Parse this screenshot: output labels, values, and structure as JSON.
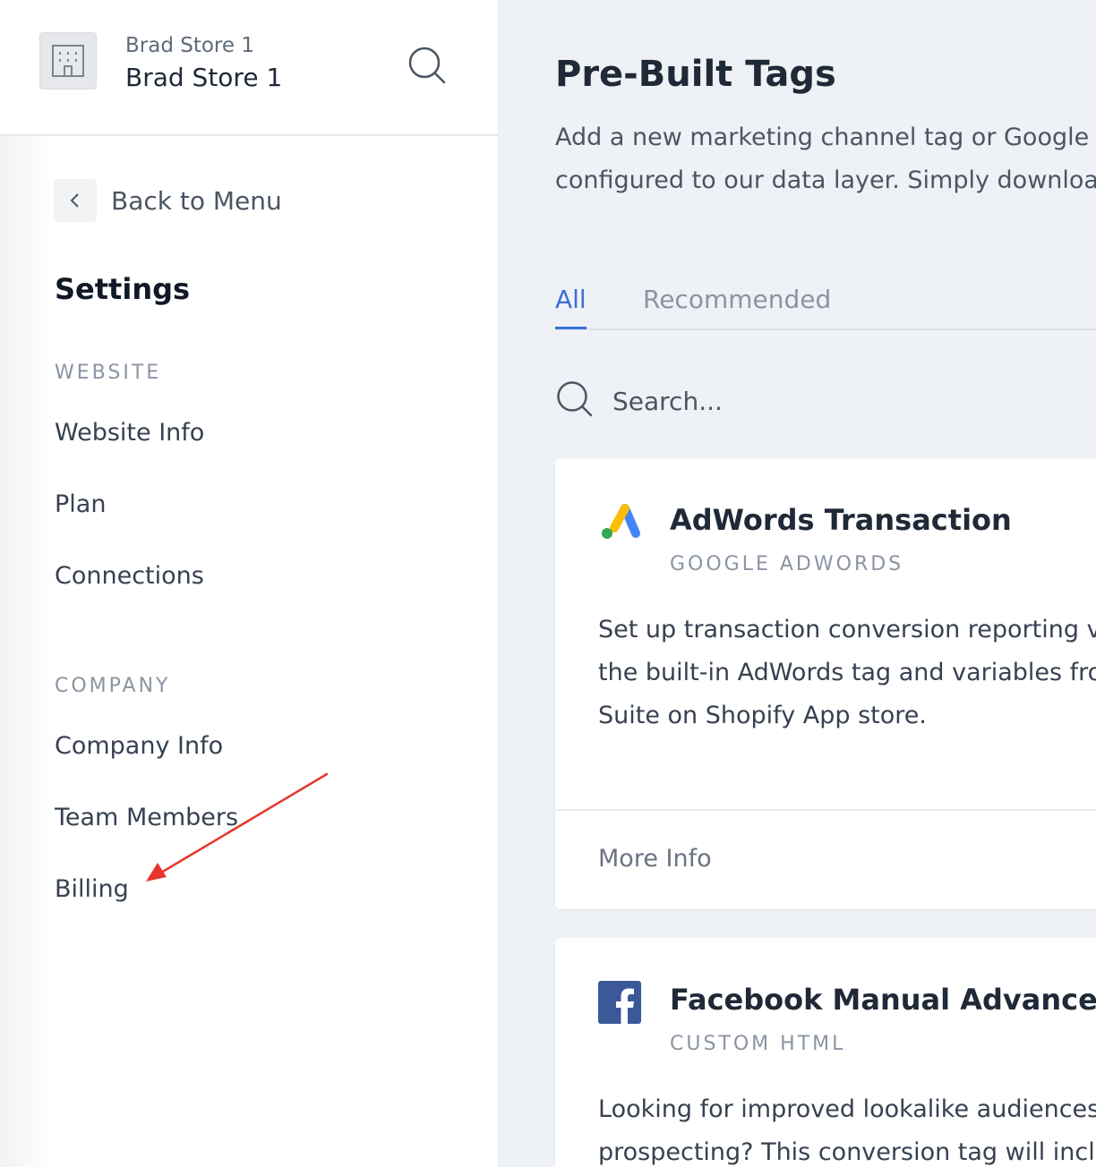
{
  "sidebar": {
    "store": {
      "subtitle": "Brad Store 1",
      "name": "Brad Store 1",
      "icon": "building-icon"
    },
    "back_label": "Back to Menu",
    "title": "Settings",
    "sections": [
      {
        "label": "WEBSITE",
        "items": [
          "Website Info",
          "Plan",
          "Connections"
        ]
      },
      {
        "label": "COMPANY",
        "items": [
          "Company Info",
          "Team Members",
          "Billing"
        ]
      }
    ],
    "annotation_color": "#e8362c"
  },
  "main": {
    "title": "Pre-Built Tags",
    "description_lines": [
      "Add a new marketing channel tag or Google A",
      "configured to our data layer. Simply download"
    ],
    "tabs": [
      {
        "label": "All",
        "active": true
      },
      {
        "label": "Recommended",
        "active": false
      }
    ],
    "search": {
      "placeholder": "Search..."
    },
    "cards": [
      {
        "title": "AdWords Transaction",
        "subtitle": "GOOGLE ADWORDS",
        "icon": "google-ads-icon",
        "description_lines": [
          "Set up transaction conversion reporting vi",
          "the built-in AdWords tag and variables fro",
          "Suite on Shopify App store."
        ],
        "link": "More Info"
      },
      {
        "title": "Facebook Manual Advanced M",
        "subtitle": "CUSTOM HTML",
        "icon": "facebook-icon",
        "description_lines": [
          "Looking for improved lookalike audiences f",
          "prospecting? This conversion tag will inclu"
        ]
      }
    ],
    "accent_color": "#3b6fd8"
  }
}
